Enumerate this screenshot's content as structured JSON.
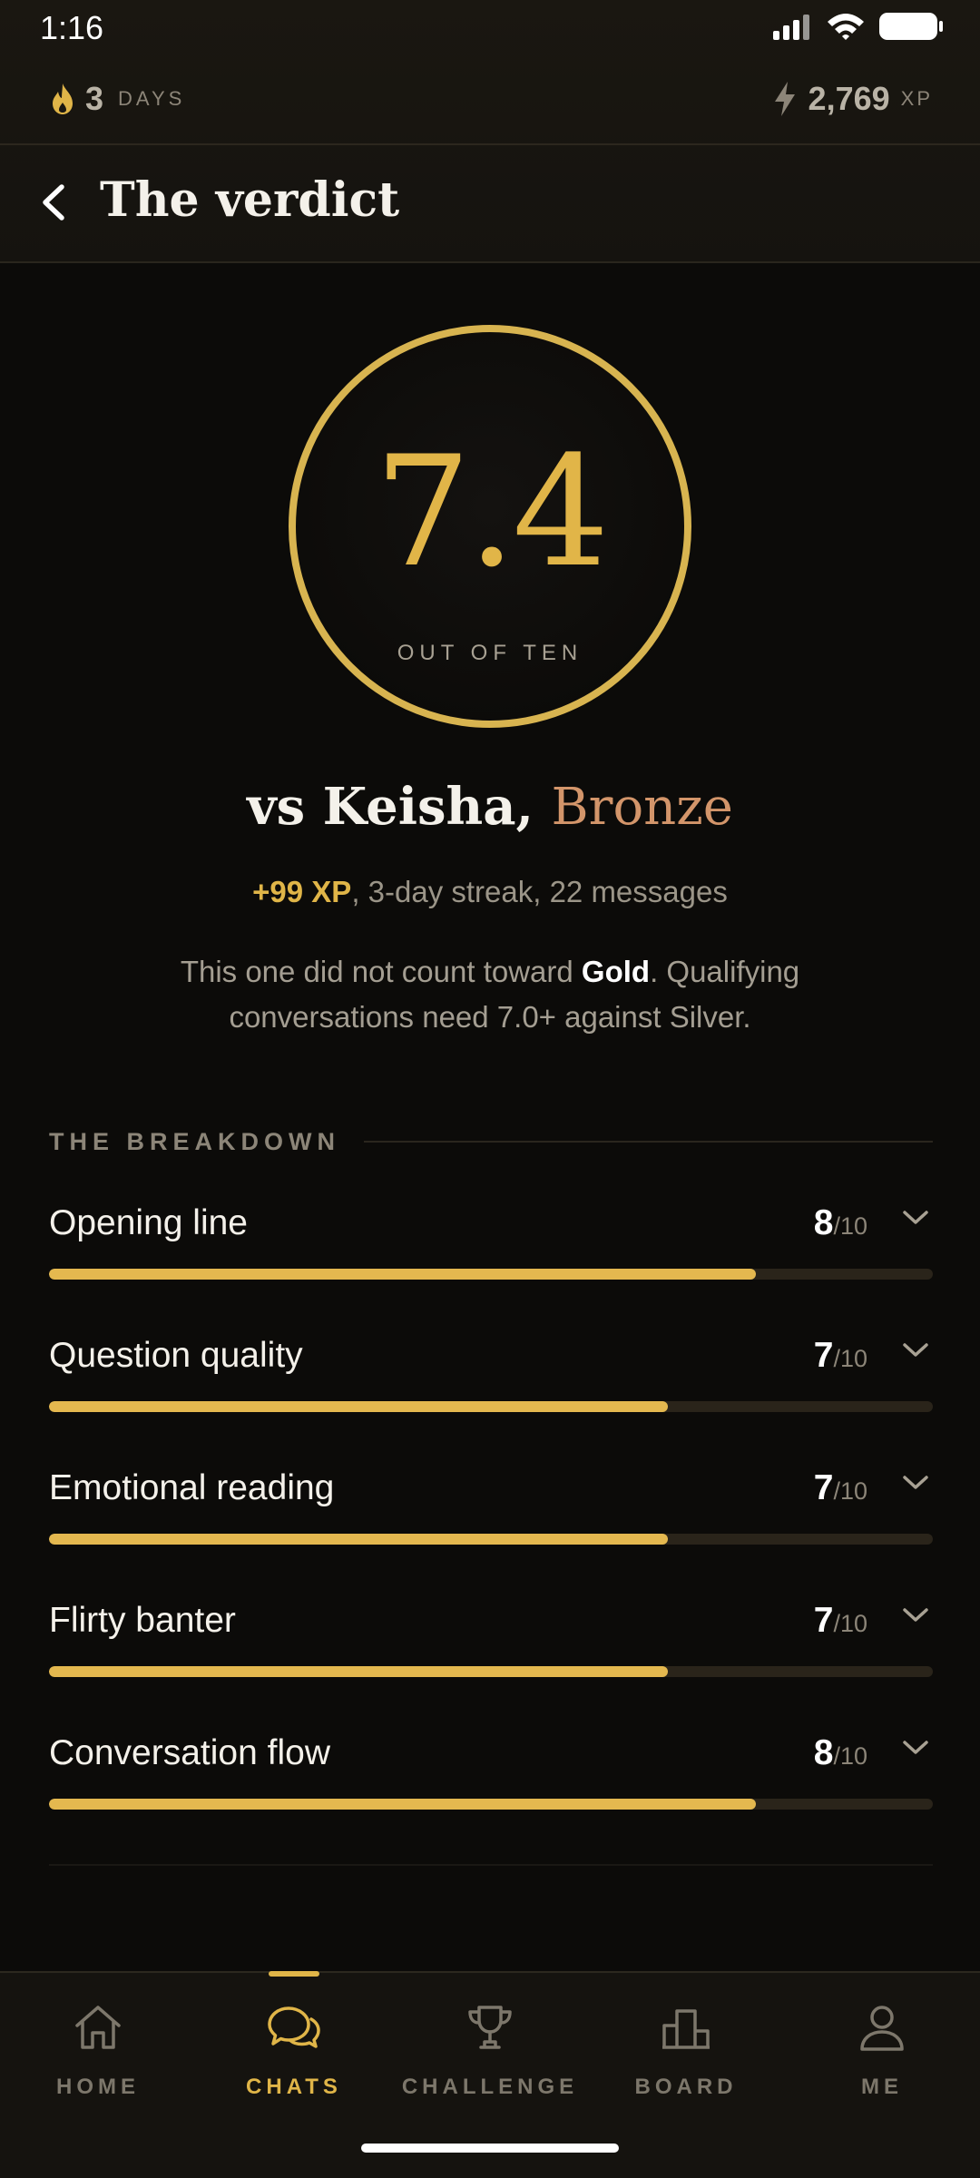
{
  "status": {
    "time": "1:16"
  },
  "streak": {
    "count": "3",
    "unit": "DAYS"
  },
  "xp": {
    "total": "2,769",
    "unit": "XP"
  },
  "header": {
    "title": "The verdict"
  },
  "score": {
    "value": "7.4",
    "subtitle": "OUT OF TEN",
    "fraction": 0.74
  },
  "opponent": {
    "prefix": "vs Keisha,",
    "tier": "Bronze",
    "tier_color": "#d3956a"
  },
  "stats": {
    "xp_gain": "+99 XP",
    "rest": ", 3-day streak, 22 messages"
  },
  "note": {
    "part1": "This one did not count toward ",
    "bold": "Gold",
    "part2": ". Qualifying conversations need 7.0+ against Silver."
  },
  "breakdown": {
    "title": "THE BREAKDOWN",
    "items": [
      {
        "label": "Opening line",
        "score": "8",
        "out_of": "/10",
        "fraction": 0.8
      },
      {
        "label": "Question quality",
        "score": "7",
        "out_of": "/10",
        "fraction": 0.7
      },
      {
        "label": "Emotional reading",
        "score": "7",
        "out_of": "/10",
        "fraction": 0.7
      },
      {
        "label": "Flirty banter",
        "score": "7",
        "out_of": "/10",
        "fraction": 0.7
      },
      {
        "label": "Conversation flow",
        "score": "8",
        "out_of": "/10",
        "fraction": 0.8
      }
    ]
  },
  "nav": {
    "items": [
      {
        "label": "HOME",
        "icon": "home-icon"
      },
      {
        "label": "CHATS",
        "icon": "chat-icon",
        "active": true
      },
      {
        "label": "CHALLENGE",
        "icon": "trophy-icon"
      },
      {
        "label": "BOARD",
        "icon": "leaderboard-icon"
      },
      {
        "label": "ME",
        "icon": "profile-icon"
      }
    ]
  },
  "colors": {
    "accent": "#e0b548",
    "background": "#0c0b09",
    "bronze": "#d3956a"
  }
}
